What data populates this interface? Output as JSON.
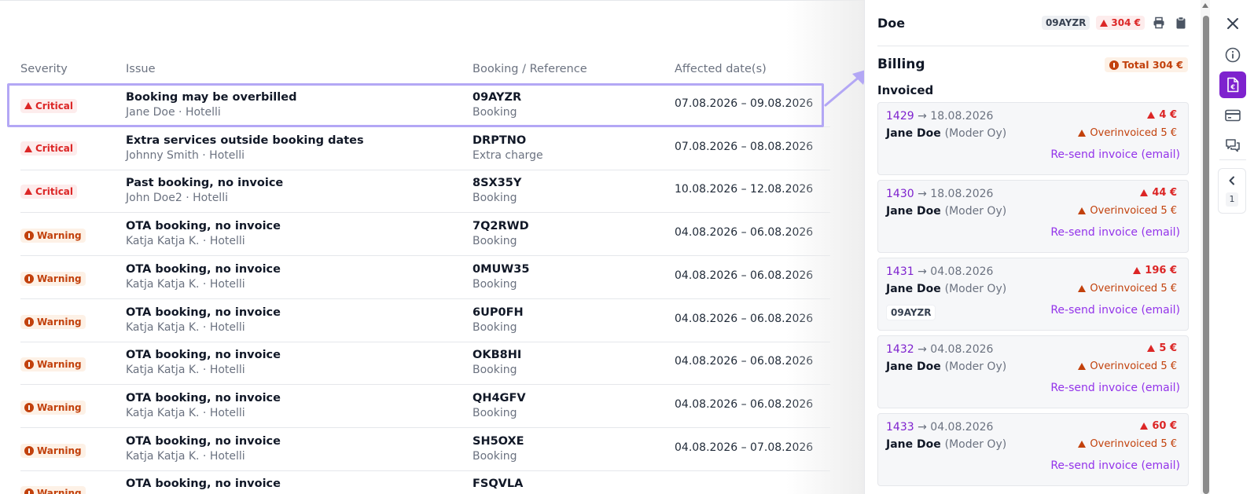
{
  "table": {
    "columns": {
      "severity": "Severity",
      "issue": "Issue",
      "reference": "Booking / Reference",
      "dates": "Affected date(s)"
    },
    "rows": [
      {
        "severity": "Critical",
        "level": "critical",
        "title": "Booking may be overbilled",
        "subtitle": "Jane Doe · Hotelli",
        "ref": "09AYZR",
        "ref_type": "Booking",
        "dates": "07.08.2026 – 09.08.2026"
      },
      {
        "severity": "Critical",
        "level": "critical",
        "title": "Extra services outside booking dates",
        "subtitle": "Johnny Smith · Hotelli",
        "ref": "DRPTNO",
        "ref_type": "Extra charge",
        "dates": "07.08.2026 – 08.08.2026"
      },
      {
        "severity": "Critical",
        "level": "critical",
        "title": "Past booking, no invoice",
        "subtitle": "John Doe2 · Hotelli",
        "ref": "8SX35Y",
        "ref_type": "Booking",
        "dates": "10.08.2026 – 12.08.2026"
      },
      {
        "severity": "Warning",
        "level": "warning",
        "title": "OTA booking, no invoice",
        "subtitle": "Katja Katja K. · Hotelli",
        "ref": "7Q2RWD",
        "ref_type": "Booking",
        "dates": "04.08.2026 – 06.08.2026"
      },
      {
        "severity": "Warning",
        "level": "warning",
        "title": "OTA booking, no invoice",
        "subtitle": "Katja Katja K. · Hotelli",
        "ref": "0MUW35",
        "ref_type": "Booking",
        "dates": "04.08.2026 – 06.08.2026"
      },
      {
        "severity": "Warning",
        "level": "warning",
        "title": "OTA booking, no invoice",
        "subtitle": "Katja Katja K. · Hotelli",
        "ref": "6UP0FH",
        "ref_type": "Booking",
        "dates": "04.08.2026 – 06.08.2026"
      },
      {
        "severity": "Warning",
        "level": "warning",
        "title": "OTA booking, no invoice",
        "subtitle": "Katja Katja K. · Hotelli",
        "ref": "OKB8HI",
        "ref_type": "Booking",
        "dates": "04.08.2026 – 06.08.2026"
      },
      {
        "severity": "Warning",
        "level": "warning",
        "title": "OTA booking, no invoice",
        "subtitle": "Katja Katja K. · Hotelli",
        "ref": "QH4GFV",
        "ref_type": "Booking",
        "dates": "04.08.2026 – 06.08.2026"
      },
      {
        "severity": "Warning",
        "level": "warning",
        "title": "OTA booking, no invoice",
        "subtitle": "Katja Katja K. · Hotelli",
        "ref": "SH5OXE",
        "ref_type": "Booking",
        "dates": "04.08.2026 – 07.08.2026"
      },
      {
        "severity": "Warning",
        "level": "warning",
        "title": "OTA booking, no invoice",
        "subtitle": "",
        "ref": "FSQVLA",
        "ref_type": "",
        "dates": ""
      }
    ]
  },
  "panel": {
    "name": "Doe",
    "ref_chip": "09AYZR",
    "amount_chip": "304 €",
    "billing_title": "Billing",
    "total_label": "Total 304 €",
    "invoiced_title": "Invoiced",
    "invoices": [
      {
        "number": "1429",
        "arrow": "→",
        "date": "18.08.2026",
        "amount": "4 €",
        "customer": "Jane Doe",
        "company": "(Moder Oy)",
        "overinvoiced": "Overinvoiced 5 €",
        "resend": "Re-send invoice (email)",
        "tag": ""
      },
      {
        "number": "1430",
        "arrow": "→",
        "date": "18.08.2026",
        "amount": "44 €",
        "customer": "Jane Doe",
        "company": "(Moder Oy)",
        "overinvoiced": "Overinvoiced 5 €",
        "resend": "Re-send invoice (email)",
        "tag": ""
      },
      {
        "number": "1431",
        "arrow": "→",
        "date": "04.08.2026",
        "amount": "196 €",
        "customer": "Jane Doe",
        "company": "(Moder Oy)",
        "overinvoiced": "Overinvoiced 5 €",
        "resend": "Re-send invoice (email)",
        "tag": "09AYZR"
      },
      {
        "number": "1432",
        "arrow": "→",
        "date": "04.08.2026",
        "amount": "5 €",
        "customer": "Jane Doe",
        "company": "(Moder Oy)",
        "overinvoiced": "Overinvoiced 5 €",
        "resend": "Re-send invoice (email)",
        "tag": ""
      },
      {
        "number": "1433",
        "arrow": "→",
        "date": "04.08.2026",
        "amount": "60 €",
        "customer": "Jane Doe",
        "company": "(Moder Oy)",
        "overinvoiced": "Overinvoiced 5 €",
        "resend": "Re-send invoice (email)",
        "tag": ""
      }
    ]
  },
  "rail": {
    "badge_count": "1",
    "icons": [
      "close-icon",
      "info-icon",
      "invoice-euro-icon",
      "credit-card-icon",
      "chat-icon",
      "chevron-left-icon"
    ]
  },
  "colors": {
    "accent": "#7e22ce",
    "critical": "#dc2626",
    "warning": "#c2410c",
    "highlight": "#b3a7f5"
  }
}
